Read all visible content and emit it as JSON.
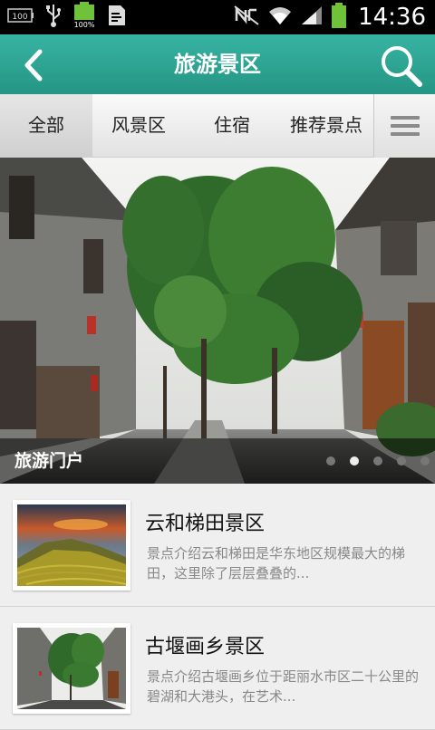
{
  "status_bar": {
    "battery_small_label": "100",
    "battery_percent": "100%",
    "time": "14:36",
    "icons": [
      "battery-small-icon",
      "usb-icon",
      "battery-full-icon",
      "sim-doc-icon",
      "nfc-off-icon",
      "wifi-icon",
      "signal-icon",
      "battery-icon"
    ]
  },
  "header": {
    "title": "旅游景区",
    "accent_color": "#2fa898"
  },
  "tabs": [
    {
      "label": "全部",
      "active": true
    },
    {
      "label": "风景区",
      "active": false
    },
    {
      "label": "住宿",
      "active": false
    },
    {
      "label": "推荐景点",
      "active": false
    }
  ],
  "banner": {
    "caption": "旅游门户",
    "slide_count": 5,
    "active_slide": 2
  },
  "list": [
    {
      "title": "云和梯田景区",
      "description": "景点介绍云和梯田是华东地区规模最大的梯田，这里除了层层叠叠的..."
    },
    {
      "title": "古堰画乡景区",
      "description": "景点介绍古堰画乡位于距丽水市区二十公里的碧湖和大港头，在艺术..."
    }
  ]
}
